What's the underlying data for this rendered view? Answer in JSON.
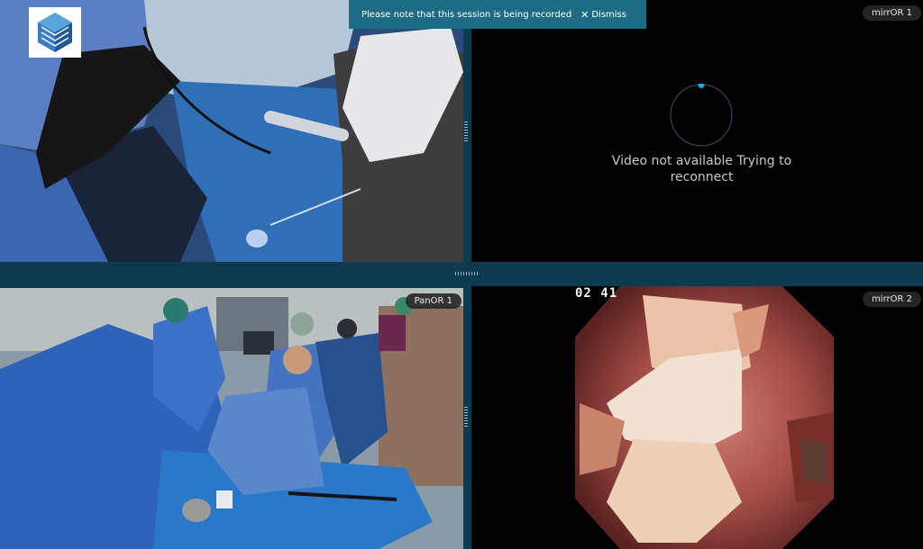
{
  "banner": {
    "message": "Please note that this session is being recorded",
    "dismiss_label": "Dismiss",
    "dismiss_icon": "close-icon"
  },
  "feeds": {
    "top_left": {
      "name": ""
    },
    "top_right": {
      "name": "mirrOR 1",
      "status_line1": "Video not available Trying to",
      "status_line2": "reconnect"
    },
    "bottom_left": {
      "name": "PanOR 1"
    },
    "bottom_right": {
      "name": "mirrOR 2",
      "timer": "02 41"
    }
  },
  "colors": {
    "background": "#0d3a4e",
    "banner": "#1e6b85",
    "spinner_accent": "#2a9fd0",
    "label_pill": "#282828"
  },
  "icons": [
    "logo-icon",
    "close-icon",
    "loading-spinner-icon",
    "resize-handle-icon"
  ]
}
